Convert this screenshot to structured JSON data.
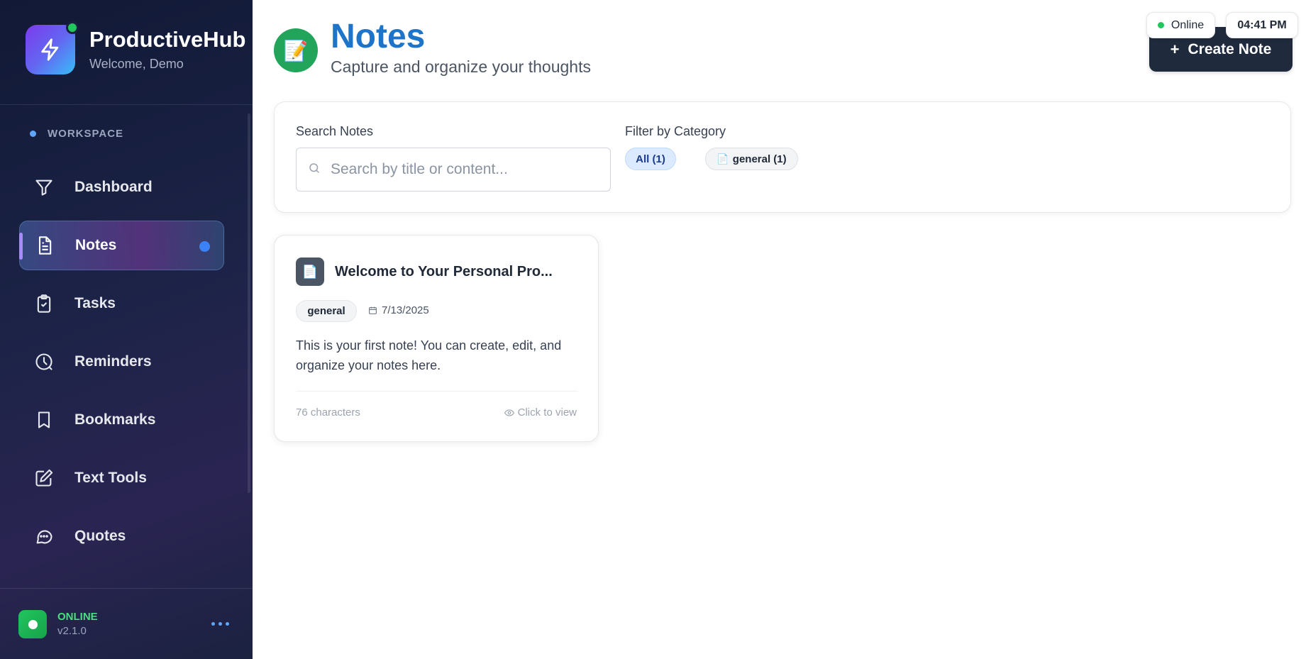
{
  "brand": {
    "title": "ProductiveHub",
    "subtitle": "Welcome, Demo"
  },
  "sidebar": {
    "section_label": "WORKSPACE",
    "items": [
      {
        "label": "Dashboard",
        "icon": "filter-icon"
      },
      {
        "label": "Notes",
        "icon": "document-icon",
        "active": true
      },
      {
        "label": "Tasks",
        "icon": "clipboard-check-icon"
      },
      {
        "label": "Reminders",
        "icon": "clock-icon"
      },
      {
        "label": "Bookmarks",
        "icon": "bookmark-icon"
      },
      {
        "label": "Text Tools",
        "icon": "edit-icon"
      },
      {
        "label": "Quotes",
        "icon": "chat-bubble-icon"
      }
    ],
    "footer": {
      "status": "ONLINE",
      "version": "v2.1.0"
    }
  },
  "header": {
    "title": "Notes",
    "subtitle": "Capture and organize your thoughts",
    "create_label": "Create Note",
    "online_label": "Online",
    "time": "04:41 PM"
  },
  "filters": {
    "search_label": "Search Notes",
    "search_placeholder": "Search by title or content...",
    "search_value": "",
    "category_label": "Filter by Category",
    "chips": [
      {
        "label": "All (1)",
        "selected": true
      },
      {
        "label": "general (1)",
        "icon": "document-icon",
        "selected": false
      }
    ]
  },
  "notes": [
    {
      "title": "Welcome to Your Personal Pro...",
      "category": "general",
      "date": "7/13/2025",
      "preview": "This is your first note! You can create, edit, and organize your notes here.",
      "char_count": "76 characters",
      "view_label": "Click to view"
    }
  ],
  "colors": {
    "accent_blue": "#1d74c9",
    "online_green": "#22c55e",
    "sidebar_bg": "#1c2347",
    "create_button_bg": "#1f2a3c"
  }
}
